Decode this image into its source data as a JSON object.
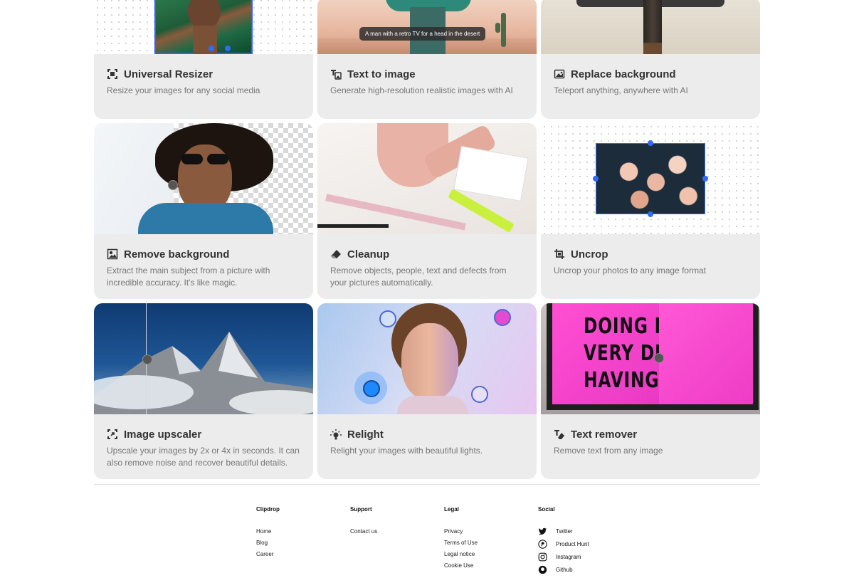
{
  "cards": [
    {
      "title": "Universal Resizer",
      "desc": "Resize your images for any social media",
      "icon": "resize-icon"
    },
    {
      "title": "Text to image",
      "desc": "Generate high-resolution realistic images with AI",
      "icon": "text-to-image-icon",
      "tooltip": "A man with a retro TV for a head in the desert"
    },
    {
      "title": "Replace background",
      "desc": "Teleport anything, anywhere with AI",
      "icon": "replace-background-icon"
    },
    {
      "title": "Remove background",
      "desc": "Extract the main subject from a picture with incredible accuracy. It's like magic.",
      "icon": "remove-background-icon"
    },
    {
      "title": "Cleanup",
      "desc": "Remove objects, people, text and defects from your pictures automatically.",
      "icon": "eraser-icon"
    },
    {
      "title": "Uncrop",
      "desc": "Uncrop your photos to any image format",
      "icon": "uncrop-icon"
    },
    {
      "title": "Image upscaler",
      "desc": "Upscale your images by 2x or 4x in seconds. It can also remove noise and recover beautiful details.",
      "icon": "upscale-icon"
    },
    {
      "title": "Relight",
      "desc": "Relight your images with beautiful lights.",
      "icon": "relight-icon"
    },
    {
      "title": "Text remover",
      "desc": "Remove text from any image",
      "icon": "text-remover-icon",
      "billboard": [
        "DOING NC",
        "VERY DIFF",
        "HAVING NOT"
      ]
    }
  ],
  "footer": {
    "clipdrop": {
      "heading": "Clipdrop",
      "links": [
        "Home",
        "Blog",
        "Career"
      ]
    },
    "support": {
      "heading": "Support",
      "links": [
        "Contact us"
      ]
    },
    "legal": {
      "heading": "Legal",
      "links": [
        "Privacy",
        "Terms of Use",
        "Legal notice",
        "Cookie Use"
      ]
    },
    "social": {
      "heading": "Social",
      "links": [
        {
          "label": "Twitter",
          "icon": "twitter-icon"
        },
        {
          "label": "Product Hunt",
          "icon": "product-hunt-icon"
        },
        {
          "label": "Instagram",
          "icon": "instagram-icon"
        },
        {
          "label": "Github",
          "icon": "github-icon"
        }
      ]
    }
  },
  "colors": {
    "card_bg": "#ececec",
    "accent_blue": "#2f6bff",
    "billboard_pink": "#f03fc8"
  }
}
